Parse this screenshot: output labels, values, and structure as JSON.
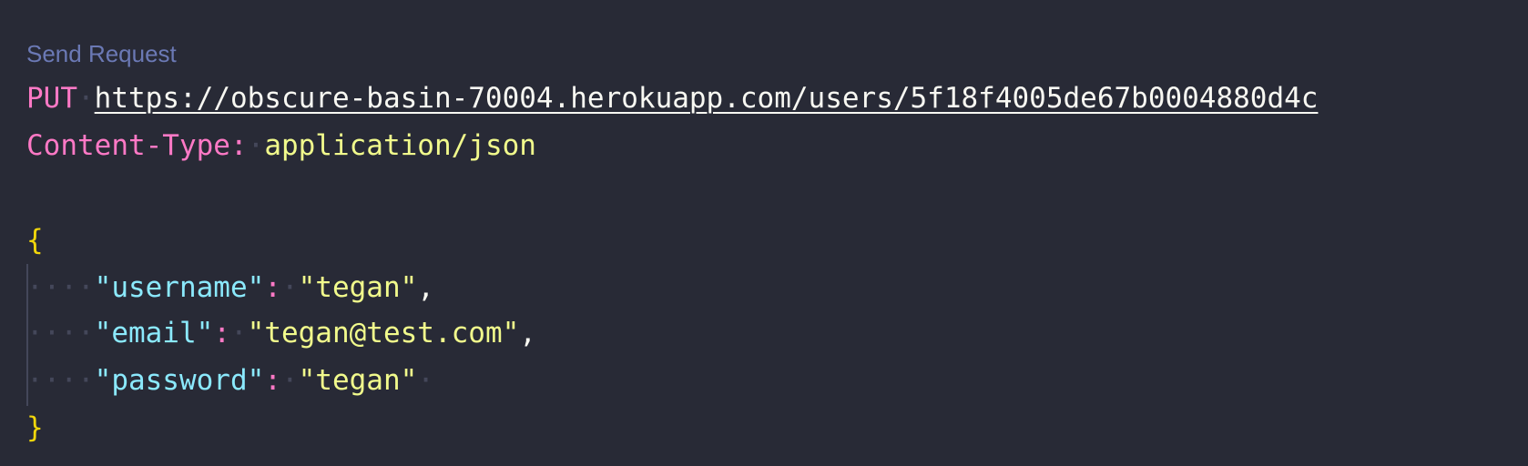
{
  "codelens": {
    "send_request_label": "Send Request"
  },
  "request": {
    "method": "PUT",
    "url": "https://obscure-basin-70004.herokuapp.com/users/5f18f4005de67b0004880d4c",
    "header_name": "Content-Type:",
    "header_value": "application/json"
  },
  "body": {
    "open_brace": "{",
    "close_brace": "}",
    "fields": [
      {
        "key": "\"username\"",
        "colon": ":",
        "value": "\"tegan\"",
        "comma": ","
      },
      {
        "key": "\"email\"",
        "colon": ":",
        "value": "\"tegan@test.com\"",
        "comma": ","
      },
      {
        "key": "\"password\"",
        "colon": ":",
        "value": "\"tegan\"",
        "comma": ""
      }
    ]
  },
  "whitespace": {
    "dot": "·",
    "indent": "····"
  },
  "colors": {
    "background": "#282a36",
    "codelens": "#6b79b5",
    "method": "#ff79c6",
    "url": "#f8f8f2",
    "header_value": "#f1fa8c",
    "json_key": "#8be9fd",
    "json_string": "#f1fa8c",
    "brace": "#f1d60b"
  }
}
